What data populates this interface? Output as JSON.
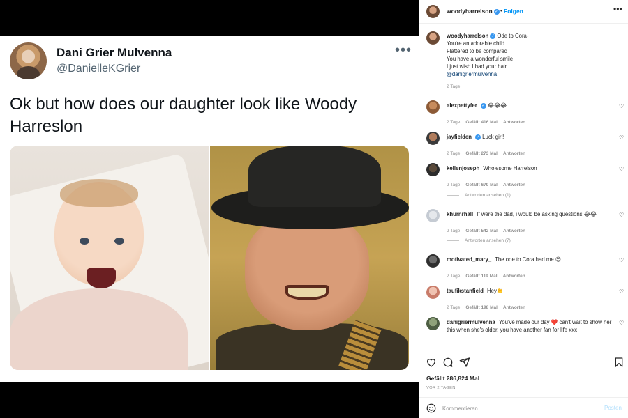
{
  "tweet": {
    "name": "Dani Grier Mulvenna",
    "handle": "@DanielleKGrier",
    "more": "•••",
    "text": "Ok but how does our daughter look like Woody Harreslon"
  },
  "post": {
    "username": "woodyharrelson",
    "follow_label": "Folgen",
    "more": "•••",
    "caption": {
      "username": "woodyharrelson",
      "lines": [
        "Ode to Cora-",
        "You're an adorable child",
        "Flattered to be compared",
        "You have a wonderful smile",
        "I just wish I had your hair"
      ],
      "mention": "@danigriermulvenna",
      "time": "2 Tage"
    },
    "comments": [
      {
        "user": "alexpettyfer",
        "text": "😂😂😂",
        "time": "2 Tage",
        "likes": "Gefällt 416 Mal",
        "reply": "Antworten",
        "verified": true
      },
      {
        "user": "jayfielden",
        "text": "Luck girl!",
        "time": "2 Tage",
        "likes": "Gefällt 273 Mal",
        "reply": "Antworten",
        "verified": true
      },
      {
        "user": "kellenjoseph",
        "text": "Wholesome Harrelson",
        "time": "2 Tage",
        "likes": "Gefällt 679 Mal",
        "reply": "Antworten",
        "replies_label": "Antworten ansehen (1)"
      },
      {
        "user": "khurnrhall",
        "text": "If were the dad, i would be asking questions 😂😂",
        "time": "2 Tage",
        "likes": "Gefällt 542 Mal",
        "reply": "Antworten",
        "replies_label": "Antworten ansehen (7)"
      },
      {
        "user": "motivated_mary_",
        "text": "The ode to Cora had me 😍",
        "time": "2 Tage",
        "likes": "Gefällt 119 Mal",
        "reply": "Antworten"
      },
      {
        "user": "taufikstanfield",
        "text": "Hey👏",
        "time": "2 Tage",
        "likes": "Gefällt 198 Mal",
        "reply": "Antworten"
      },
      {
        "user": "danigriermulvenna",
        "text": "You've made our day ❤️ can't wait to show her this when she's older, you have another fan for life xxx"
      }
    ],
    "likes_total": "Gefällt 286,824 Mal",
    "posted": "VOR 2 TAGEN",
    "comment_placeholder": "Kommentieren ...",
    "post_label": "Posten"
  },
  "icons": [
    "verified-badge",
    "heart-icon",
    "comment-icon",
    "share-icon",
    "bookmark-icon",
    "emoji-icon",
    "more-icon"
  ],
  "colors": {
    "accent": "#0095f6",
    "verified": "#3897f0",
    "muted": "#8e8e8e",
    "text": "#262626",
    "post_disabled": "#b2dffc"
  }
}
